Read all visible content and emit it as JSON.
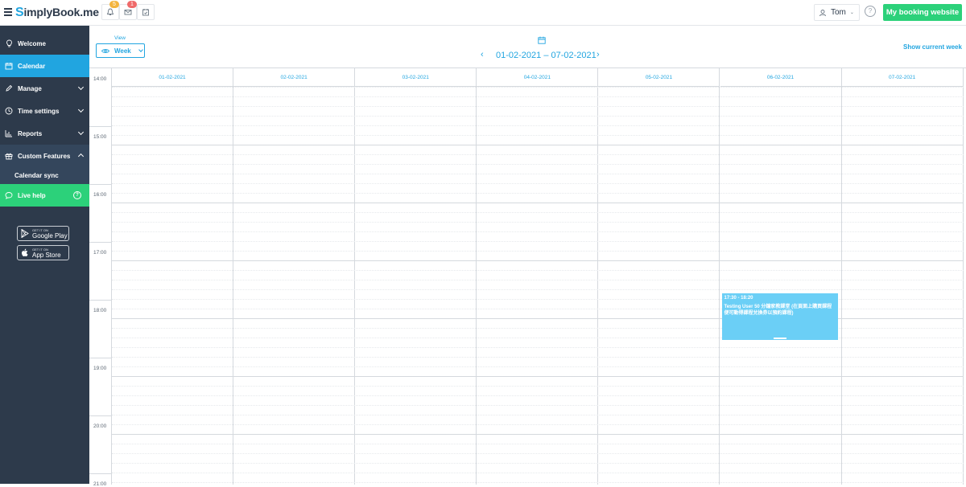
{
  "header": {
    "logo_s": "S",
    "logo_text": "implyBook",
    "logo_suffix": ".me",
    "notifications_count": "5",
    "messages_count": "1",
    "user_name": "Tom",
    "help_label": "?",
    "booking_button": "My booking website"
  },
  "sidebar": {
    "items": [
      {
        "label": "Welcome"
      },
      {
        "label": "Calendar"
      },
      {
        "label": "Manage"
      },
      {
        "label": "Time settings"
      },
      {
        "label": "Reports"
      },
      {
        "label": "Custom Features"
      },
      {
        "label": "Calendar sync"
      },
      {
        "label": "Live help"
      }
    ],
    "google_small": "GET IT ON",
    "google_big": "Google Play",
    "apple_small": "GET IT ON",
    "apple_big": "App Store"
  },
  "toolbar": {
    "view_label": "View",
    "view_value": "Week",
    "date_range": "01-02-2021 – 07-02-2021",
    "prev": "‹",
    "next": "›",
    "show_current": "Show current week"
  },
  "calendar": {
    "days": [
      "01-02-2021",
      "02-02-2021",
      "03-02-2021",
      "04-02-2021",
      "05-02-2021",
      "06-02-2021",
      "07-02-2021"
    ],
    "hours": [
      "14:00",
      "15:00",
      "16:00",
      "17:00",
      "18:00",
      "19:00",
      "20:00",
      "21:00"
    ],
    "event": {
      "time": "17:30 - 18:20",
      "title": "Testing User 50 分鐘家教課堂 (在頁面上購買課程便可動得課程兌換券以預約課程)",
      "day_index": 5
    }
  },
  "colors": {
    "accent": "#21a5e0",
    "sidebar": "#2d3a4b",
    "green": "#2cd17a",
    "event": "#6bcff6"
  }
}
